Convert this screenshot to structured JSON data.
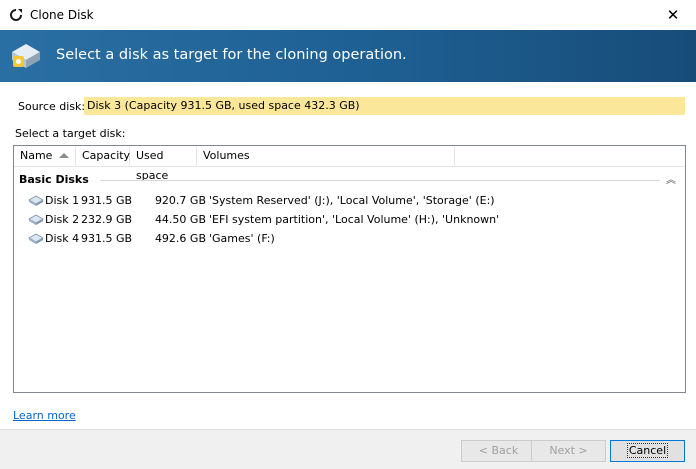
{
  "window": {
    "title": "Clone Disk",
    "close_glyph": "✕"
  },
  "banner": {
    "heading": "Select a disk as target for the cloning operation."
  },
  "source": {
    "label": "Source disk:",
    "value": "Disk 3 (Capacity 931.5 GB, used space 432.3 GB)"
  },
  "target": {
    "label": "Select a target disk:"
  },
  "list": {
    "columns": [
      "Name",
      "Capacity",
      "Used space",
      "Volumes"
    ],
    "group": "Basic Disks",
    "rows": [
      {
        "name": "Disk 1",
        "capacity": "931.5 GB",
        "used": "920.7 GB",
        "volumes": "'System Reserved' (J:), 'Local Volume', 'Storage' (E:)"
      },
      {
        "name": "Disk 2",
        "capacity": "232.9 GB",
        "used": "44.50 GB",
        "volumes": "'EFI system partition', 'Local Volume' (H:), 'Unknown'"
      },
      {
        "name": "Disk 4",
        "capacity": "931.5 GB",
        "used": "492.6 GB",
        "volumes": "'Games' (F:)"
      }
    ]
  },
  "footer": {
    "learn_more": "Learn more",
    "back": "< Back",
    "next": "Next >",
    "cancel": "Cancel"
  },
  "icons": {
    "app": "clone-disk-app-icon",
    "banner": "disk-wizard-icon",
    "disk": "disk-icon",
    "collapse": "collapse-group-icon"
  }
}
